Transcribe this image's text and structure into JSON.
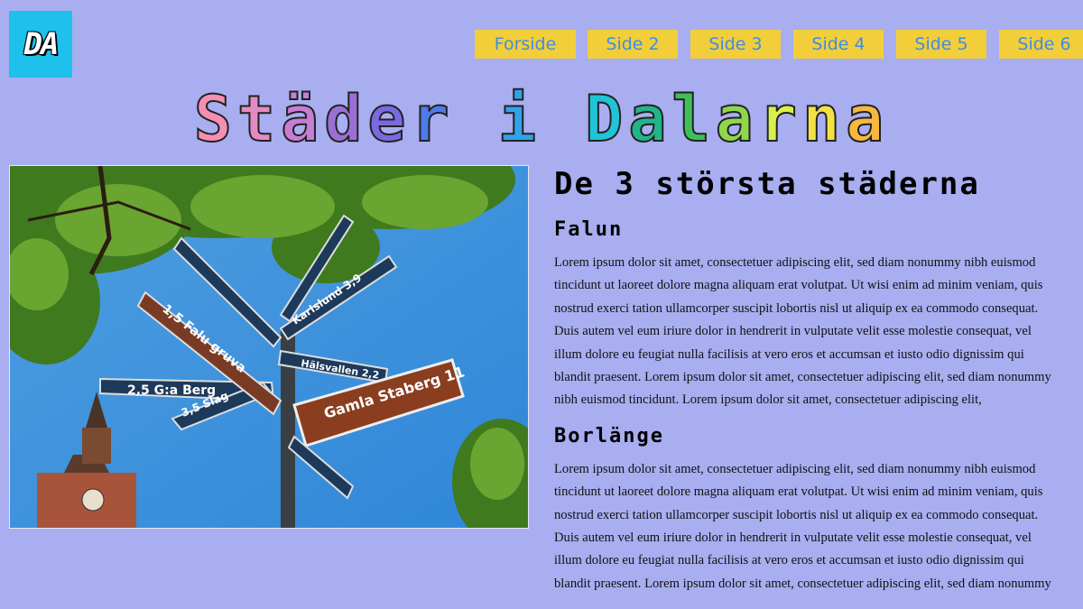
{
  "logo": {
    "text": "DA"
  },
  "nav": [
    "Forside",
    "Side 2",
    "Side 3",
    "Side 4",
    "Side 5",
    "Side 6"
  ],
  "title": "Städer i Dalarna",
  "title_colors": [
    "#f48fb1",
    "#e58ac4",
    "#c77dd1",
    "#9b6fd6",
    "#7a6ae0",
    "#4f7be8",
    "#31a3e8",
    "#1fc4d6",
    "#22b58a",
    "#3fbf5a",
    "#8fd64b",
    "#d8f04a",
    "#f3e045",
    "#f6b83e",
    "#f59a3a",
    "#f28537"
  ],
  "sign_texts": {
    "gamla_staberg": "Gamla Staberg 11",
    "ga_berg": "2,5 G:a Berg",
    "slag": "3,5 Slag",
    "falu_gruva": "1,5 Falu gruva",
    "karlslund": "Karlslund 3,9",
    "hakvallen": "Hälsvallen 2,2"
  },
  "article": {
    "heading": "De 3 största städerna",
    "sections": [
      {
        "title": "Falun",
        "body": "Lorem ipsum dolor sit amet, consectetuer adipiscing elit, sed diam nonummy nibh euismod tincidunt ut laoreet dolore magna aliquam erat volutpat. Ut wisi enim ad minim veniam, quis nostrud exerci tation ullamcorper suscipit lobortis nisl ut aliquip ex ea commodo consequat. Duis autem vel eum iriure dolor in hendrerit in vulputate velit esse molestie consequat, vel illum dolore eu feugiat nulla facilisis at vero eros et accumsan et iusto odio dignissim qui blandit praesent. Lorem ipsum dolor sit amet, consectetuer adipiscing elit, sed diam nonummy nibh euismod tincidunt. Lorem ipsum dolor sit amet, consectetuer adipiscing elit,"
      },
      {
        "title": "Borlänge",
        "body": "Lorem ipsum dolor sit amet, consectetuer adipiscing elit, sed diam nonummy nibh euismod tincidunt ut laoreet dolore magna aliquam erat volutpat. Ut wisi enim ad minim veniam, quis nostrud exerci tation ullamcorper suscipit lobortis nisl ut aliquip ex ea commodo consequat. Duis autem vel eum iriure dolor in hendrerit in vulputate velit esse molestie consequat, vel illum dolore eu feugiat nulla facilisis at vero eros et accumsan et iusto odio dignissim qui blandit praesent. Lorem ipsum dolor sit amet, consectetuer adipiscing elit, sed diam nonummy"
      }
    ]
  }
}
